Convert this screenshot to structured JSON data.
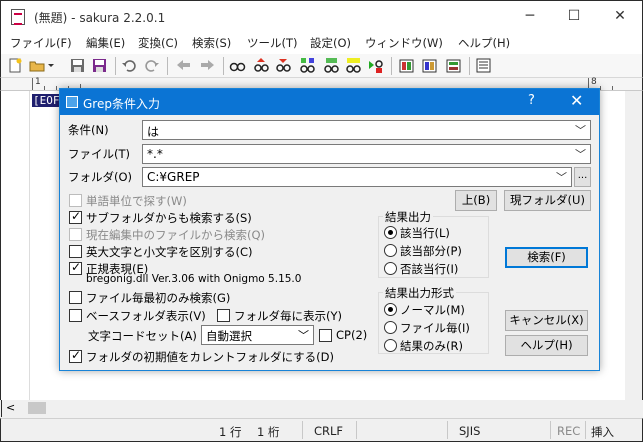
{
  "window": {
    "title": "(無題) - sakura 2.2.0.1",
    "minimize": "─",
    "maximize": "☐",
    "close": "✕"
  },
  "menu": [
    "ファイル(F)",
    "編集(E)",
    "変換(C)",
    "検索(S)",
    "ツール(T)",
    "設定(O)",
    "ウィンドウ(W)",
    "ヘルプ(H)"
  ],
  "ruler": {
    "marks": [
      "1",
      "8"
    ]
  },
  "editor": {
    "eof_marker": "[EOF]"
  },
  "dialog": {
    "title": "Grep条件入力",
    "help_icon": "?",
    "close_icon": "✕",
    "condition_label": "条件(N)",
    "condition_value": "は",
    "file_label": "ファイル(T)",
    "file_value": "*.*",
    "folder_label": "フォルダ(O)",
    "folder_value": "C:¥GREP",
    "browse_button": "...",
    "up_button": "上(B)",
    "current_folder_button": "現フォルダ(U)",
    "options": {
      "word_unit": {
        "label": "単語単位で探す(W)",
        "checked": false,
        "enabled": false
      },
      "subfolders": {
        "label": "サブフォルダからも検索する(S)",
        "checked": true,
        "enabled": true
      },
      "current_file": {
        "label": "現在編集中のファイルから検索(Q)",
        "checked": false,
        "enabled": false
      },
      "case_sensitive": {
        "label": "英大文字と小文字を区別する(C)",
        "checked": false,
        "enabled": true
      },
      "regex": {
        "label": "正規表現(E)",
        "checked": true,
        "enabled": true
      },
      "regex_engine": "bregonig.dll Ver.3.06 with Onigmo 5.15.0",
      "first_match_only": {
        "label": "ファイル毎最初のみ検索(G)",
        "checked": false,
        "enabled": true
      },
      "base_folder": {
        "label": "ベースフォルダ表示(V)",
        "checked": false,
        "enabled": true
      },
      "per_folder": {
        "label": "フォルダ毎に表示(Y)",
        "checked": false,
        "enabled": true
      },
      "encoding_label": "文字コードセット(A)",
      "encoding_value": "自動選択",
      "cp": {
        "label": "CP(2)",
        "checked": false,
        "enabled": true
      },
      "init_folder": {
        "label": "フォルダの初期値をカレントフォルダにする(D)",
        "checked": true,
        "enabled": true
      }
    },
    "output_group": {
      "title": "結果出力",
      "items": [
        "該当行(L)",
        "該当部分(P)",
        "否該当行(I)"
      ],
      "selected": 0
    },
    "format_group": {
      "title": "結果出力形式",
      "items": [
        "ノーマル(M)",
        "ファイル毎(I)",
        "結果のみ(R)"
      ],
      "selected": 0
    },
    "search_button": "検索(F)",
    "cancel_button": "キャンセル(X)",
    "help_button": "ヘルプ(H)"
  },
  "status": {
    "line": "1 行",
    "column": "1 桁",
    "eol": "CRLF",
    "encoding": "SJIS",
    "rec": "REC",
    "mode": "挿入"
  }
}
